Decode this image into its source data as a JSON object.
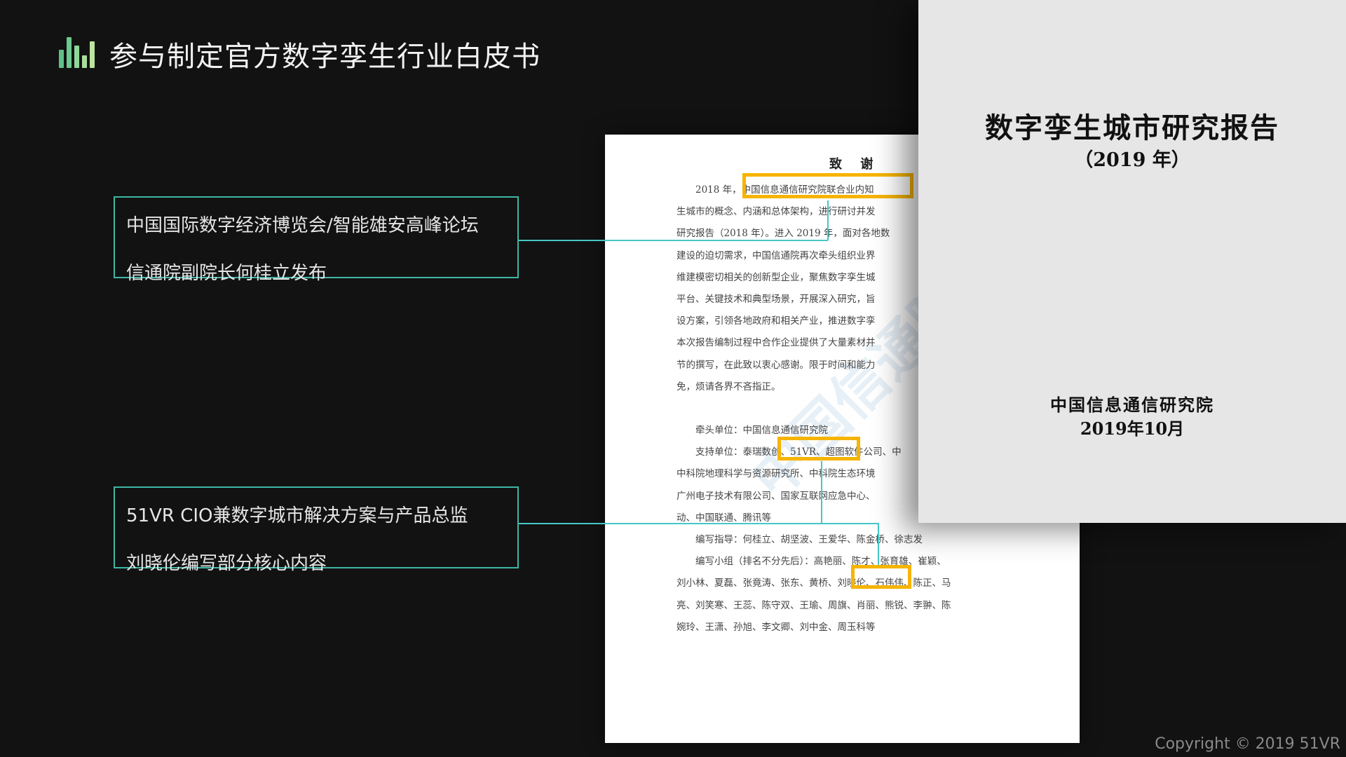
{
  "header": {
    "title": "参与制定官方数字孪生行业白皮书",
    "logo_icon": "bar-chart-icon"
  },
  "callouts": [
    {
      "line1": "中国国际数字经济博览会/智能雄安高峰论坛",
      "line2": "信通院副院长何桂立发布"
    },
    {
      "line1": "51VR CIO兼数字城市解决方案与产品总监",
      "line2": "刘晓伦编写部分核心内容"
    }
  ],
  "document": {
    "heading": "致 谢",
    "lines": [
      "　　2018 年，中国信息通信研究院联合业内知",
      "生城市的概念、内涵和总体架构，进行研讨并发",
      "研究报告（2018 年）。进入 2019 年，面对各地数",
      "建设的迫切需求，中国信通院再次牵头组织业界",
      "维建模密切相关的创新型企业，聚焦数字孪生城",
      "平台、关键技术和典型场景，开展深入研究，旨",
      "设方案，引领各地政府和相关产业，推进数字孪",
      "本次报告编制过程中合作企业提供了大量素材并",
      "节的撰写，在此致以衷心感谢。限于时间和能力",
      "免，烦请各界不吝指正。",
      "",
      "　　牵头单位：中国信息通信研究院",
      "　　支持单位：泰瑞数创、51VR、超图软件公司、中",
      "中科院地理科学与资源研究所、中科院生态环境",
      "广州电子技术有限公司、国家互联网应急中心、",
      "动、中国联通、腾讯等",
      "　　编写指导：何桂立、胡坚波、王爱华、陈金桥、徐志发",
      "　　编写小组（排名不分先后）：高艳丽、陈才、张育雄、崔颖、",
      "刘小林、夏磊、张竟涛、张东、黄桥、刘晓伦、石伟伟、陈正、马",
      "亮、刘笑寒、王蕊、陈守双、王瑜、周旗、肖丽、熊锐、李翀、陈",
      "婉玲、王潇、孙旭、李文卿、刘中金、周玉科等"
    ],
    "watermark": "中国信通院"
  },
  "cover": {
    "title": "数字孪生城市研究报告",
    "year": "（2019 年）",
    "org": "中国信息通信研究院",
    "date": "2019年10月"
  },
  "footer": {
    "copyright": "Copyright © 2019 51VR"
  },
  "colors": {
    "accent": "#3fb6a4",
    "line": "#46c6c6",
    "highlight": "#f6b400"
  }
}
